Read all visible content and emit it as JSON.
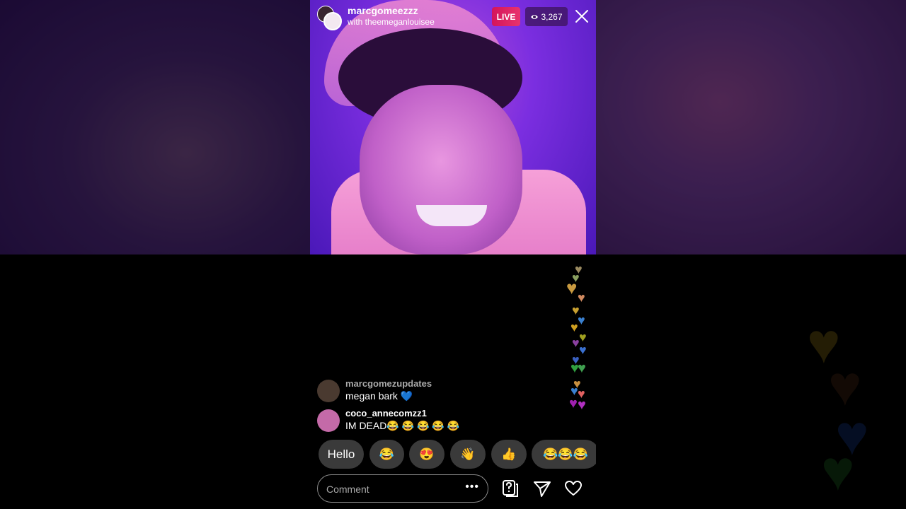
{
  "stream": {
    "host_username": "marcgomeezzz",
    "guest_line": "with theemeganlouisee",
    "live_label": "LIVE",
    "viewer_count": "3,267"
  },
  "comments": [
    {
      "username": "marcgomezupdates",
      "text": "megan bark 💙",
      "avatar_color": "#4a3a30"
    },
    {
      "username": "coco_annecomzz1",
      "text": "IM DEAD😂 😂 😂 😂 😂",
      "avatar_color": "#c46aa8"
    }
  ],
  "quick_replies": [
    "Hello",
    "😂",
    "😍",
    "👋",
    "👍",
    "😂😂😂"
  ],
  "comment_input": {
    "placeholder": "Comment",
    "more_label": "•••"
  },
  "icons": {
    "close": "close-icon",
    "viewers": "eye-icon",
    "question": "question-box-icon",
    "share": "paper-plane-icon",
    "like": "heart-icon"
  },
  "colors": {
    "live_red": "#e1306c",
    "accent_purple": "#7b2ee0"
  }
}
